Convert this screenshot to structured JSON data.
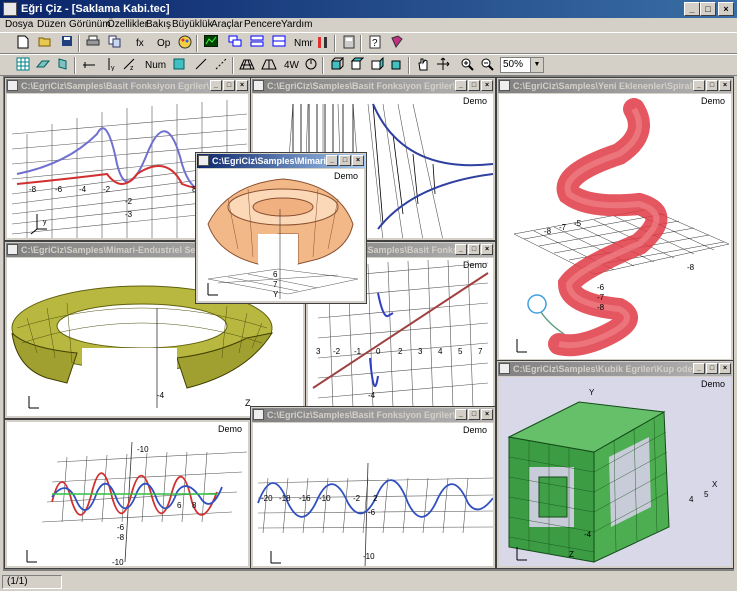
{
  "app": {
    "title": "Eğri Çiz - [Saklama Kabi.tec]"
  },
  "menu": [
    "Dosya",
    "Düzen",
    "Görünüm",
    "Özellikler",
    "Bakış",
    "Büyüklük",
    "Araçlar",
    "Pencere",
    "Yardım"
  ],
  "toolbar1": {
    "fx": "fx",
    "op": "Op",
    "nmr": "Nmr"
  },
  "toolbar2": {
    "num": "Num",
    "fourw": "4W",
    "zoom": "50%"
  },
  "windows": [
    {
      "title": "C:\\EgriCiz\\Samples\\Basit Fonksiyon Egriler\\",
      "demo": "Demo"
    },
    {
      "title": "C:\\EgriCiz\\Samples\\Basit Fonksiyon Egriler\\",
      "demo": "Demo"
    },
    {
      "title": "C:\\EgriCiz\\Samples\\Yeni Eklenenler\\Spiral...",
      "demo": "Demo"
    },
    {
      "title": "C:\\EgriCiz\\Samples\\Mimari-Endustriel Sekil",
      "demo": "Demo"
    },
    {
      "title": "C:\\EgriCiz\\Samples\\Basit Fonksiyon Egriler\\",
      "demo": "Demo"
    },
    {
      "title": "C:\\EgriCiz\\Samples\\Kubik Egriler\\Kup ode...",
      "demo": "Demo"
    },
    {
      "title": "",
      "demo": "Demo"
    },
    {
      "title": "C:\\EgriCiz\\Samples\\Basit Fonksiyon Egriler\\",
      "demo": "Demo"
    },
    {
      "title": "C:\\EgriCiz\\Samples\\Mimari...",
      "demo": "Demo"
    }
  ],
  "status": {
    "pane1": "(1/1)"
  },
  "colors": {
    "active_caption": "#0a246a",
    "inactive_caption": "#808080",
    "grid": "#333333",
    "torus": "#a8a830",
    "spiral": "#e0303a",
    "cube": "#3aa040",
    "dish": "#f0b080"
  }
}
